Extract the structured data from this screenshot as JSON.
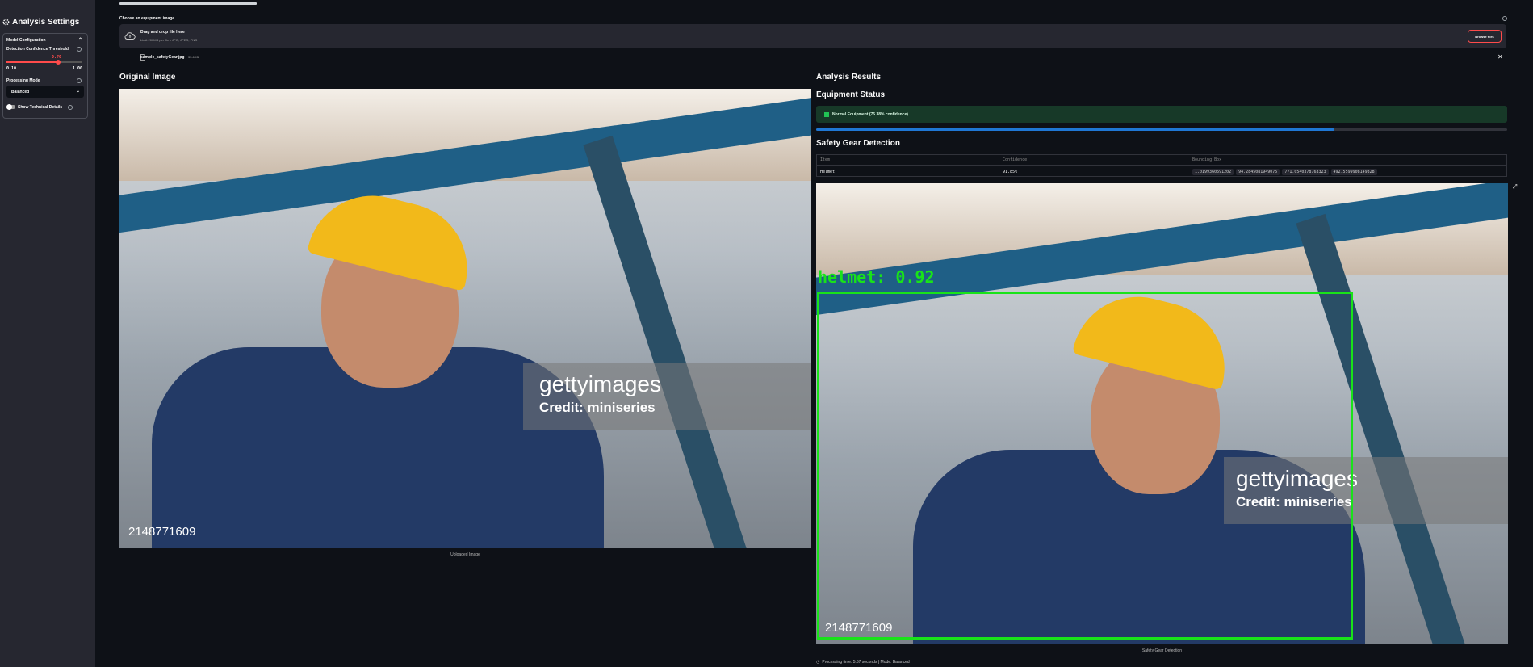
{
  "sidebar": {
    "title": "Analysis Settings",
    "section": "Model Configuration",
    "threshold_label": "Detection Confidence Threshold",
    "threshold_value": "0.70",
    "threshold_min": "0.10",
    "threshold_max": "1.00",
    "threshold_fraction": 0.67,
    "mode_label": "Processing Mode",
    "mode_value": "Balanced",
    "toggle_label": "Show Technical Details"
  },
  "main": {
    "chooser_label": "Choose an equipment image...",
    "drop_title": "Drag and drop file here",
    "drop_limit": "Limit 200MB per file • JPG, JPEG, PNG",
    "browse_label": "Browse files",
    "file_name": "sample_safetyGear.jpg",
    "file_size": "35.6KB",
    "original_heading": "Original Image",
    "original_caption": "Uploaded Image",
    "results_heading": "Analysis Results",
    "status_heading": "Equipment Status",
    "status_text": "Normal Equipment (75.38% confidence)",
    "status_progress": 0.75,
    "gear_heading": "Safety Gear Detection",
    "table": {
      "headers": [
        "Item",
        "Confidence",
        "Bounding Box"
      ],
      "row": {
        "item": "Helmet",
        "confidence": "91.85%",
        "bbox": [
          "1.0199360591202",
          "94.2845081949075",
          "771.0540378763323",
          "492.5599908149328"
        ]
      }
    },
    "detection_label": "helmet: 0.92",
    "detection_caption": "Safety Gear Detection",
    "footer": "Processing time: 5.57 seconds | Mode: Balanced",
    "watermark_brand": "gettyimages",
    "watermark_credit": "Credit: miniseries",
    "watermark_id": "2148771609"
  },
  "colors": {
    "accent": "#ff4b4b",
    "success": "#21c354",
    "progress": "#1f77d4",
    "box": "#19e319"
  }
}
